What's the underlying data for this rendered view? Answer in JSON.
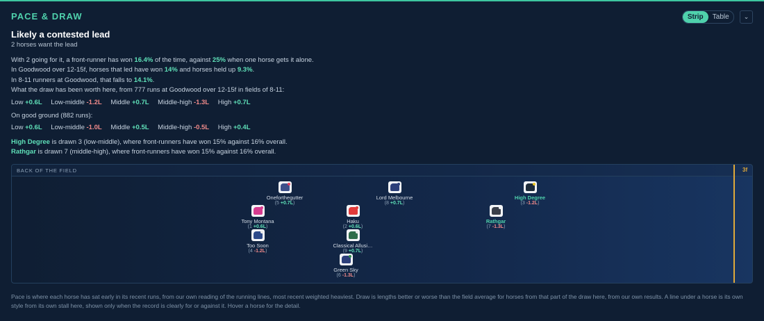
{
  "header": {
    "title": "PACE & DRAW"
  },
  "toggle": {
    "strip": "Strip",
    "table": "Table"
  },
  "headline": {
    "title": "Likely a contested lead",
    "subtitle": "2 horses want the lead"
  },
  "stats": {
    "l1_a": "With 2 going for it, a front-runner has won ",
    "l1_b": "16.4%",
    "l1_c": " of the time, against ",
    "l1_d": "25%",
    "l1_e": " when one horse gets it alone.",
    "l2_a": "In Goodwood over 12-15f, horses that led have won ",
    "l2_b": "14%",
    "l2_c": " and horses held up ",
    "l2_d": "9.3%",
    "l2_e": ".",
    "l3_a": "In 8-11 runners at Goodwood, that falls to ",
    "l3_b": "14.1%",
    "l3_c": ".",
    "l4": "What the draw has been worth here, from 777 runs at Goodwood over 12-15f in fields of 8-11:"
  },
  "draw_all": [
    {
      "label": "Low",
      "value": "+0.6L",
      "tone": "g"
    },
    {
      "label": "Low-middle",
      "value": "-1.2L",
      "tone": "r"
    },
    {
      "label": "Middle",
      "value": "+0.7L",
      "tone": "g"
    },
    {
      "label": "Middle-high",
      "value": "-1.3L",
      "tone": "r"
    },
    {
      "label": "High",
      "value": "+0.7L",
      "tone": "g"
    }
  ],
  "ground": {
    "label": "On good ground (882 runs):"
  },
  "draw_good": [
    {
      "label": "Low",
      "value": "+0.6L",
      "tone": "g"
    },
    {
      "label": "Low-middle",
      "value": "-1.0L",
      "tone": "r"
    },
    {
      "label": "Middle",
      "value": "+0.5L",
      "tone": "g"
    },
    {
      "label": "Middle-high",
      "value": "-0.5L",
      "tone": "r"
    },
    {
      "label": "High",
      "value": "+0.4L",
      "tone": "g"
    }
  ],
  "notes": {
    "n1_horse": "High Degree",
    "n1_text": " is drawn 3 (low-middle), where front-runners have won 15% against 16% overall.",
    "n2_horse": "Rathgar",
    "n2_text": " is drawn 7 (middle-high), where front-runners have won 15% against 16% overall."
  },
  "strip": {
    "back_label": "BACK OF THE FIELD",
    "marker_label": "3f"
  },
  "horses": [
    {
      "name": "Oneforthegutter",
      "draw": "5",
      "value": "+0.7L",
      "tone": "g",
      "silk": "#3d4f8a",
      "dot": "#e23a5b",
      "hl": false
    },
    {
      "name": "Lord Melbourne",
      "draw": "8",
      "value": "+0.7L",
      "tone": "g",
      "silk": "#2c3f7a",
      "dot": "#2c3f7a",
      "hl": false
    },
    {
      "name": "High Degree",
      "draw": "3",
      "value": "-1.2L",
      "tone": "r",
      "silk": "#1d2b3a",
      "dot": "#e8c21f",
      "hl": true
    },
    {
      "name": "Tony Montana",
      "draw": "1",
      "value": "+0.6L",
      "tone": "g",
      "silk": "#d63b8f",
      "dot": "#d63b8f",
      "hl": false
    },
    {
      "name": "Haku",
      "draw": "2",
      "value": "+0.6L",
      "tone": "g",
      "silk": "#e23a3a",
      "dot": "#e23a3a",
      "hl": false
    },
    {
      "name": "Rathgar",
      "draw": "7",
      "value": "-1.3L",
      "tone": "r",
      "silk": "#3a3f4a",
      "dot": "#f2f4f7",
      "hl": true
    },
    {
      "name": "Too Soon",
      "draw": "4",
      "value": "-1.2L",
      "tone": "r",
      "silk": "#2d4a8a",
      "dot": "#e8e8e8",
      "hl": false
    },
    {
      "name": "Classical Allusi…",
      "draw": "9",
      "value": "+0.7L",
      "tone": "g",
      "silk": "#2f6d4a",
      "dot": "#e8e8e8",
      "hl": false
    },
    {
      "name": "Green Sky",
      "draw": "6",
      "value": "-1.3L",
      "tone": "r",
      "silk": "#2c3f7a",
      "dot": "#2f8a4a",
      "hl": false
    }
  ],
  "footer": "Pace is where each horse has sat early in its recent runs, from our own reading of the running lines, most recent weighted heaviest. Draw is lengths better or worse than the field average for horses from that part of the draw here, from our own results. A line under a horse is its own style from its own stall here, shown only when the record is clearly for or against it. Hover a horse for the detail."
}
